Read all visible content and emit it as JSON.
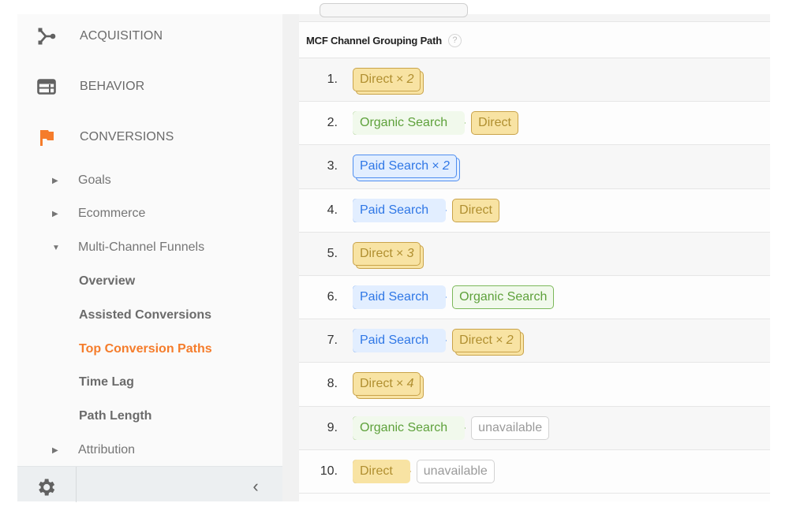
{
  "sidebar": {
    "sections": [
      {
        "label": "ACQUISITION",
        "icon": "acquisition-icon"
      },
      {
        "label": "BEHAVIOR",
        "icon": "behavior-icon"
      },
      {
        "label": "CONVERSIONS",
        "icon": "flag-icon",
        "color": "#f57c2b"
      }
    ],
    "subitems": [
      {
        "label": "Goals",
        "caret": "▶",
        "state": "collapsed"
      },
      {
        "label": "Ecommerce",
        "caret": "▶",
        "state": "collapsed"
      },
      {
        "label": "Multi-Channel Funnels",
        "caret": "▼",
        "state": "expanded"
      }
    ],
    "leaves": [
      {
        "label": "Overview",
        "active": false
      },
      {
        "label": "Assisted Conversions",
        "active": false
      },
      {
        "label": "Top Conversion Paths",
        "active": true
      },
      {
        "label": "Time Lag",
        "active": false
      },
      {
        "label": "Path Length",
        "active": false
      }
    ],
    "attribution": {
      "label": "Attribution",
      "caret": "▶"
    },
    "footer": {
      "settings_icon": "gear-icon",
      "collapse_glyph": "‹"
    },
    "active_color": "#f57c2b"
  },
  "table": {
    "header": "MCF Channel Grouping Path",
    "help_glyph": "?",
    "rows": [
      {
        "index": "1.",
        "path": [
          {
            "channel": "Direct",
            "mult": "× 2",
            "type": "direct"
          }
        ]
      },
      {
        "index": "2.",
        "path": [
          {
            "channel": "Organic Search",
            "type": "organic"
          },
          {
            "channel": "Direct",
            "type": "direct"
          }
        ]
      },
      {
        "index": "3.",
        "path": [
          {
            "channel": "Paid Search",
            "mult": "× 2",
            "type": "paid"
          }
        ]
      },
      {
        "index": "4.",
        "path": [
          {
            "channel": "Paid Search",
            "type": "paid"
          },
          {
            "channel": "Direct",
            "type": "direct"
          }
        ]
      },
      {
        "index": "5.",
        "path": [
          {
            "channel": "Direct",
            "mult": "× 3",
            "type": "direct"
          }
        ]
      },
      {
        "index": "6.",
        "path": [
          {
            "channel": "Paid Search",
            "type": "paid"
          },
          {
            "channel": "Organic Search",
            "type": "organic"
          }
        ]
      },
      {
        "index": "7.",
        "path": [
          {
            "channel": "Paid Search",
            "type": "paid"
          },
          {
            "channel": "Direct",
            "mult": "× 2",
            "type": "direct"
          }
        ]
      },
      {
        "index": "8.",
        "path": [
          {
            "channel": "Direct",
            "mult": "× 4",
            "type": "direct"
          }
        ]
      },
      {
        "index": "9.",
        "path": [
          {
            "channel": "Organic Search",
            "type": "organic"
          },
          {
            "channel": "unavailable",
            "type": "unavail"
          }
        ]
      },
      {
        "index": "10.",
        "path": [
          {
            "channel": "Direct",
            "type": "direct"
          },
          {
            "channel": "unavailable",
            "type": "unavail"
          }
        ]
      }
    ]
  },
  "colors": {
    "direct": {
      "bg": "#f8e3a3",
      "border": "#c9a34a",
      "text": "#b08f30"
    },
    "organic": {
      "bg": "#f1f9ec",
      "border": "#7cb85a",
      "text": "#5ea13b"
    },
    "paid": {
      "bg": "#e2eeff",
      "border": "#4f8ef0",
      "text": "#2f77e6"
    },
    "unavail": {
      "bg": "#ffffff",
      "border": "#d3d3d3",
      "text": "#9a9a9a"
    }
  }
}
